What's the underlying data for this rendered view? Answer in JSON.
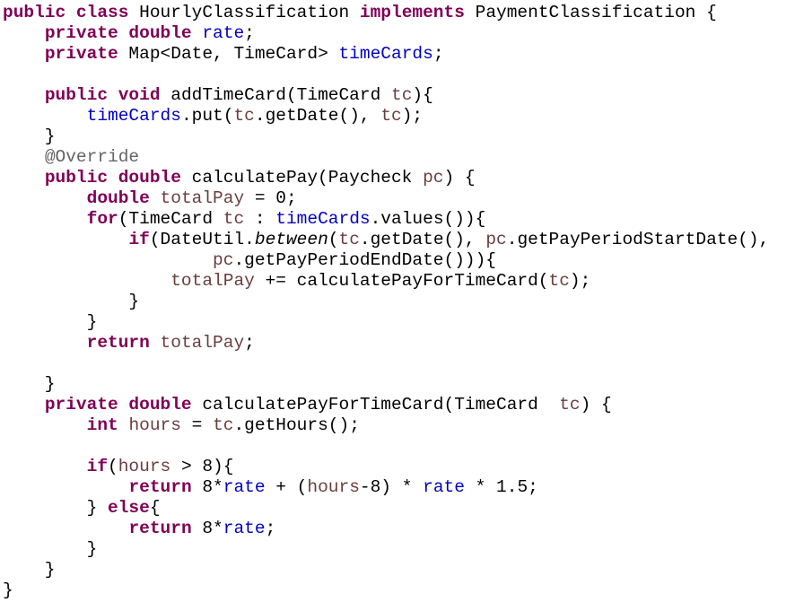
{
  "editor": {
    "language": "Java",
    "colors": {
      "background": "#ffffff",
      "keyword": "#7f0055",
      "field": "#0000c0",
      "local": "#6a3e3e",
      "annotation": "#646464",
      "text": "#000000"
    },
    "lines": [
      [
        {
          "text": "public class",
          "kind": "keyword"
        },
        {
          "text": " HourlyClassification ",
          "kind": "plain"
        },
        {
          "text": "implements",
          "kind": "keyword"
        },
        {
          "text": " PaymentClassification {",
          "kind": "plain"
        }
      ],
      [
        {
          "text": "    ",
          "kind": "plain"
        },
        {
          "text": "private double",
          "kind": "keyword"
        },
        {
          "text": " ",
          "kind": "plain"
        },
        {
          "text": "rate",
          "kind": "field"
        },
        {
          "text": ";",
          "kind": "plain"
        }
      ],
      [
        {
          "text": "    ",
          "kind": "plain"
        },
        {
          "text": "private",
          "kind": "keyword"
        },
        {
          "text": " Map<Date, TimeCard> ",
          "kind": "plain"
        },
        {
          "text": "timeCards",
          "kind": "field"
        },
        {
          "text": ";",
          "kind": "plain"
        }
      ],
      [],
      [
        {
          "text": "    ",
          "kind": "plain"
        },
        {
          "text": "public void",
          "kind": "keyword"
        },
        {
          "text": " addTimeCard(TimeCard ",
          "kind": "plain"
        },
        {
          "text": "tc",
          "kind": "local"
        },
        {
          "text": "){",
          "kind": "plain"
        }
      ],
      [
        {
          "text": "        ",
          "kind": "plain"
        },
        {
          "text": "timeCards",
          "kind": "field"
        },
        {
          "text": ".put(",
          "kind": "plain"
        },
        {
          "text": "tc",
          "kind": "local"
        },
        {
          "text": ".getDate(), ",
          "kind": "plain"
        },
        {
          "text": "tc",
          "kind": "local"
        },
        {
          "text": ");",
          "kind": "plain"
        }
      ],
      [
        {
          "text": "    }",
          "kind": "plain"
        }
      ],
      [
        {
          "text": "    ",
          "kind": "plain"
        },
        {
          "text": "@Override",
          "kind": "annotation"
        }
      ],
      [
        {
          "text": "    ",
          "kind": "plain"
        },
        {
          "text": "public double",
          "kind": "keyword"
        },
        {
          "text": " calculatePay(Paycheck ",
          "kind": "plain"
        },
        {
          "text": "pc",
          "kind": "local"
        },
        {
          "text": ") {",
          "kind": "plain"
        }
      ],
      [
        {
          "text": "        ",
          "kind": "plain"
        },
        {
          "text": "double",
          "kind": "keyword"
        },
        {
          "text": " ",
          "kind": "plain"
        },
        {
          "text": "totalPay",
          "kind": "local"
        },
        {
          "text": " = 0;",
          "kind": "plain"
        }
      ],
      [
        {
          "text": "        ",
          "kind": "plain"
        },
        {
          "text": "for",
          "kind": "keyword"
        },
        {
          "text": "(TimeCard ",
          "kind": "plain"
        },
        {
          "text": "tc",
          "kind": "local"
        },
        {
          "text": " : ",
          "kind": "plain"
        },
        {
          "text": "timeCards",
          "kind": "field"
        },
        {
          "text": ".values()){",
          "kind": "plain"
        }
      ],
      [
        {
          "text": "            ",
          "kind": "plain"
        },
        {
          "text": "if",
          "kind": "keyword"
        },
        {
          "text": "(DateUtil.",
          "kind": "plain"
        },
        {
          "text": "between",
          "kind": "static-call"
        },
        {
          "text": "(",
          "kind": "plain"
        },
        {
          "text": "tc",
          "kind": "local"
        },
        {
          "text": ".getDate(), ",
          "kind": "plain"
        },
        {
          "text": "pc",
          "kind": "local"
        },
        {
          "text": ".getPayPeriodStartDate(),",
          "kind": "plain"
        }
      ],
      [
        {
          "text": "                    ",
          "kind": "plain"
        },
        {
          "text": "pc",
          "kind": "local"
        },
        {
          "text": ".getPayPeriodEndDate())){",
          "kind": "plain"
        }
      ],
      [
        {
          "text": "                ",
          "kind": "plain"
        },
        {
          "text": "totalPay",
          "kind": "local"
        },
        {
          "text": " += calculatePayForTimeCard(",
          "kind": "plain"
        },
        {
          "text": "tc",
          "kind": "local"
        },
        {
          "text": ");",
          "kind": "plain"
        }
      ],
      [
        {
          "text": "            }",
          "kind": "plain"
        }
      ],
      [
        {
          "text": "        }",
          "kind": "plain"
        }
      ],
      [
        {
          "text": "        ",
          "kind": "plain"
        },
        {
          "text": "return",
          "kind": "keyword"
        },
        {
          "text": " ",
          "kind": "plain"
        },
        {
          "text": "totalPay",
          "kind": "local"
        },
        {
          "text": ";",
          "kind": "plain"
        }
      ],
      [],
      [
        {
          "text": "    }",
          "kind": "plain"
        }
      ],
      [
        {
          "text": "    ",
          "kind": "plain"
        },
        {
          "text": "private double",
          "kind": "keyword"
        },
        {
          "text": " calculatePayForTimeCard(TimeCard  ",
          "kind": "plain"
        },
        {
          "text": "tc",
          "kind": "local"
        },
        {
          "text": ") {",
          "kind": "plain"
        }
      ],
      [
        {
          "text": "        ",
          "kind": "plain"
        },
        {
          "text": "int",
          "kind": "keyword"
        },
        {
          "text": " ",
          "kind": "plain"
        },
        {
          "text": "hours",
          "kind": "local"
        },
        {
          "text": " = ",
          "kind": "plain"
        },
        {
          "text": "tc",
          "kind": "local"
        },
        {
          "text": ".getHours();",
          "kind": "plain"
        }
      ],
      [],
      [
        {
          "text": "        ",
          "kind": "plain"
        },
        {
          "text": "if",
          "kind": "keyword"
        },
        {
          "text": "(",
          "kind": "plain"
        },
        {
          "text": "hours",
          "kind": "local"
        },
        {
          "text": " > 8){",
          "kind": "plain"
        }
      ],
      [
        {
          "text": "            ",
          "kind": "plain"
        },
        {
          "text": "return",
          "kind": "keyword"
        },
        {
          "text": " 8*",
          "kind": "plain"
        },
        {
          "text": "rate",
          "kind": "field"
        },
        {
          "text": " + (",
          "kind": "plain"
        },
        {
          "text": "hours",
          "kind": "local"
        },
        {
          "text": "-8) * ",
          "kind": "plain"
        },
        {
          "text": "rate",
          "kind": "field"
        },
        {
          "text": " * 1.5;",
          "kind": "plain"
        }
      ],
      [
        {
          "text": "        } ",
          "kind": "plain"
        },
        {
          "text": "else",
          "kind": "keyword"
        },
        {
          "text": "{",
          "kind": "plain"
        }
      ],
      [
        {
          "text": "            ",
          "kind": "plain"
        },
        {
          "text": "return",
          "kind": "keyword"
        },
        {
          "text": " 8*",
          "kind": "plain"
        },
        {
          "text": "rate",
          "kind": "field"
        },
        {
          "text": ";",
          "kind": "plain"
        }
      ],
      [
        {
          "text": "        }",
          "kind": "plain"
        }
      ],
      [
        {
          "text": "    }",
          "kind": "plain"
        }
      ],
      [
        {
          "text": "}",
          "kind": "plain"
        }
      ]
    ]
  }
}
